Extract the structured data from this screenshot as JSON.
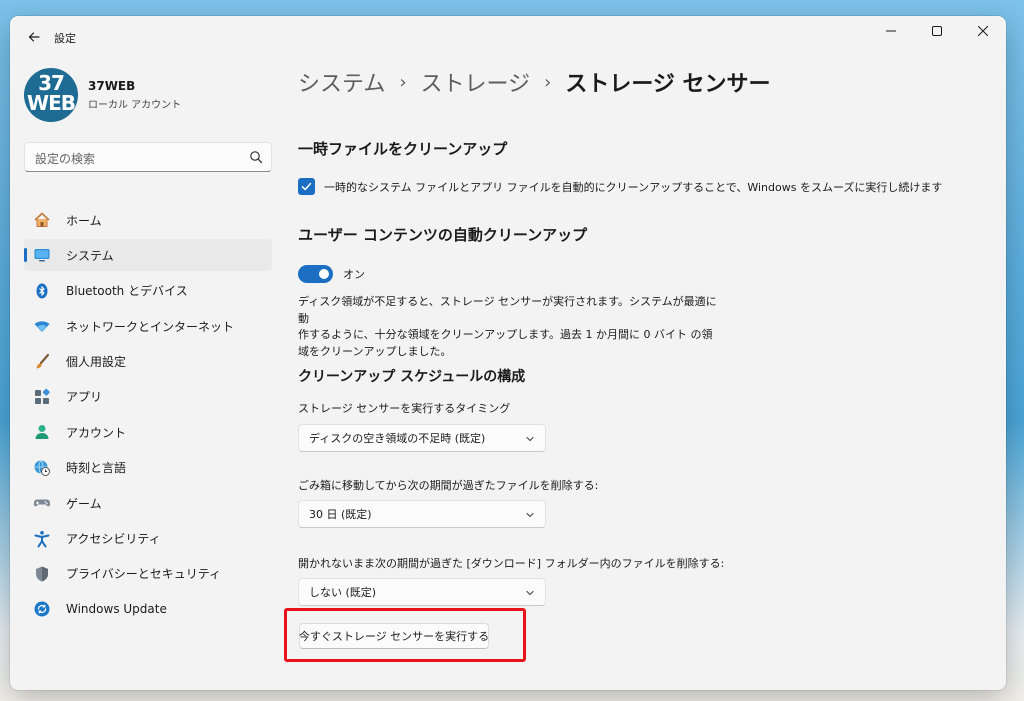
{
  "window": {
    "title": "設定",
    "back_icon": "back-arrow-icon",
    "controls": [
      "minimize-icon",
      "maximize-icon",
      "close-icon"
    ]
  },
  "profile": {
    "avatar_text": "37WEB",
    "name": "37WEB",
    "account_type": "ローカル アカウント"
  },
  "search": {
    "placeholder": "設定の検索"
  },
  "sidebar": {
    "items": [
      {
        "label": "ホーム",
        "icon": "home-icon"
      },
      {
        "label": "システム",
        "icon": "system-monitor-icon",
        "active": true
      },
      {
        "label": "Bluetooth とデバイス",
        "icon": "bluetooth-icon"
      },
      {
        "label": "ネットワークとインターネット",
        "icon": "wifi-icon"
      },
      {
        "label": "個人用設定",
        "icon": "brush-icon"
      },
      {
        "label": "アプリ",
        "icon": "apps-icon"
      },
      {
        "label": "アカウント",
        "icon": "account-icon"
      },
      {
        "label": "時刻と言語",
        "icon": "globe-clock-icon"
      },
      {
        "label": "ゲーム",
        "icon": "gamepad-icon"
      },
      {
        "label": "アクセシビリティ",
        "icon": "accessibility-icon"
      },
      {
        "label": "プライバシーとセキュリティ",
        "icon": "shield-icon"
      },
      {
        "label": "Windows Update",
        "icon": "update-icon"
      }
    ]
  },
  "breadcrumb": {
    "items": [
      "システム",
      "ストレージ"
    ],
    "current": "ストレージ センサー",
    "separator": "›"
  },
  "temp_files": {
    "title": "一時ファイルをクリーンアップ",
    "checkbox_label": "一時的なシステム ファイルとアプリ ファイルを自動的にクリーンアップすることで、Windows をスムーズに実行し続けます",
    "checked": true
  },
  "auto_cleanup": {
    "title": "ユーザー コンテンツの自動クリーンアップ",
    "toggle_state": "オン",
    "description_lines": [
      "ディスク領域が不足すると、ストレージ センサーが実行されます。システムが最適に動",
      "作するように、十分な領域をクリーンアップします。過去 1 か月間に 0 バイト の領",
      "域をクリーンアップしました。"
    ]
  },
  "schedule": {
    "title": "クリーンアップ スケジュールの構成",
    "fields": [
      {
        "label": "ストレージ センサーを実行するタイミング",
        "value": "ディスクの空き領域の不足時 (既定)"
      },
      {
        "label": "ごみ箱に移動してから次の期間が過ぎたファイルを削除する:",
        "value": "30 日 (既定)"
      },
      {
        "label": "開かれないまま次の期間が過ぎた [ダウンロード] フォルダー内のファイルを削除する:",
        "value": "しない (既定)"
      }
    ]
  },
  "run_button": {
    "label": "今すぐストレージ センサーを実行する"
  },
  "colors": {
    "accent": "#1b6ec2",
    "highlight_frame": "#e8121b",
    "window_bg": "#f3f3f3"
  }
}
